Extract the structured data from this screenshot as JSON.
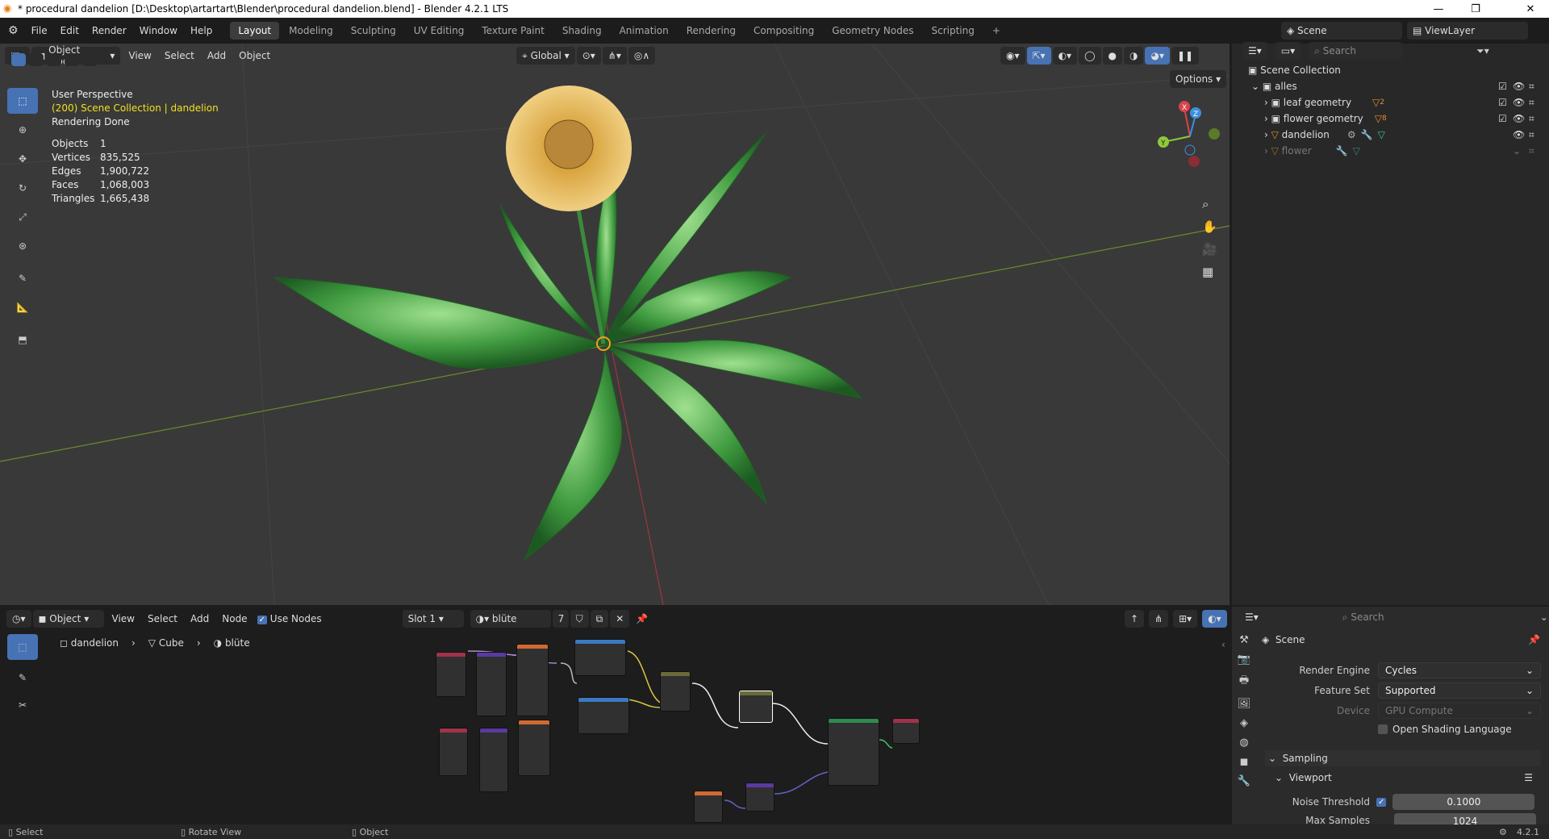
{
  "window": {
    "title": "* procedural dandelion [D:\\Desktop\\artartart\\Blender\\procedural dandelion.blend] - Blender 4.2.1 LTS",
    "minimize": "—",
    "maximize": "❐",
    "close": "✕"
  },
  "menu": [
    "File",
    "Edit",
    "Render",
    "Window",
    "Help"
  ],
  "workspaces": [
    "Layout",
    "Modeling",
    "Sculpting",
    "UV Editing",
    "Texture Paint",
    "Shading",
    "Animation",
    "Rendering",
    "Compositing",
    "Geometry Nodes",
    "Scripting"
  ],
  "active_workspace": "Layout",
  "scene": {
    "name": "Scene",
    "view_layer": "ViewLayer"
  },
  "viewport": {
    "mode": "Object Mode",
    "menus": [
      "View",
      "Select",
      "Add",
      "Object"
    ],
    "transform_orientation": "Global",
    "options_label": "Options",
    "perspective": "User Perspective",
    "collection_info": "(200) Scene Collection | dandelion",
    "render_status": "Rendering Done",
    "stats": [
      {
        "label": "Objects",
        "value": "1"
      },
      {
        "label": "Vertices",
        "value": "835,525"
      },
      {
        "label": "Edges",
        "value": "1,900,722"
      },
      {
        "label": "Faces",
        "value": "1,068,003"
      },
      {
        "label": "Triangles",
        "value": "1,665,438"
      }
    ],
    "gizmo_axes": {
      "x": "X",
      "y": "Y",
      "z": "Z"
    }
  },
  "outliner": {
    "search_placeholder": "Search",
    "root": "Scene Collection",
    "items": [
      {
        "name": "alles",
        "type": "collection"
      },
      {
        "name": "leaf geometry",
        "badge": "2"
      },
      {
        "name": "flower geometry",
        "badge": "8"
      },
      {
        "name": "dandelion"
      },
      {
        "name": "flower"
      }
    ]
  },
  "node_editor": {
    "type": "Object",
    "menus": [
      "View",
      "Select",
      "Add",
      "Node"
    ],
    "use_nodes_label": "Use Nodes",
    "slot": "Slot 1",
    "material": "blüte",
    "users": "7",
    "breadcrumb": [
      "dandelion",
      "Cube",
      "blüte"
    ]
  },
  "properties": {
    "search_placeholder": "Search",
    "context": "Scene",
    "render_engine_label": "Render Engine",
    "render_engine": "Cycles",
    "feature_set_label": "Feature Set",
    "feature_set": "Supported",
    "device_label": "Device",
    "device": "GPU Compute",
    "osl_label": "Open Shading Language",
    "sampling": "Sampling",
    "viewport": "Viewport",
    "noise_threshold_label": "Noise Threshold",
    "noise_threshold": "0.1000",
    "max_samples_label": "Max Samples",
    "max_samples": "1024"
  },
  "statusbar": {
    "select": "Select",
    "rotate": "Rotate View",
    "object": "Object",
    "version": "4.2.1"
  },
  "colors": {
    "accent": "#4772b3",
    "leaf": "#3f9a3f",
    "flower": "#e0b24a",
    "x_axis": "#d8434c",
    "y_axis": "#8fc93a",
    "z_axis": "#3d8fe0"
  }
}
